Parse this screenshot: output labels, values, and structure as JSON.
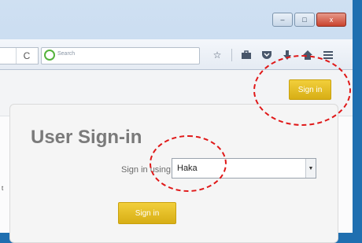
{
  "browser": {
    "reload_icon": "C",
    "search_placeholder": "Search",
    "toolbar_icons": [
      "star-icon",
      "briefcase-icon",
      "pocket-icon",
      "download-icon",
      "home-icon",
      "menu-icon"
    ]
  },
  "window_controls": {
    "minimize": "–",
    "maximize": "□",
    "close": "x"
  },
  "page": {
    "header_signin_label": "Sign in",
    "card": {
      "title": "User Sign-in",
      "signin_using_label": "Sign in using",
      "select_value": "Haka",
      "signin_button_label": "Sign in"
    },
    "left_edge_char": "t"
  },
  "colors": {
    "accent_button": "#e1bb22",
    "annotation": "#e01818"
  }
}
